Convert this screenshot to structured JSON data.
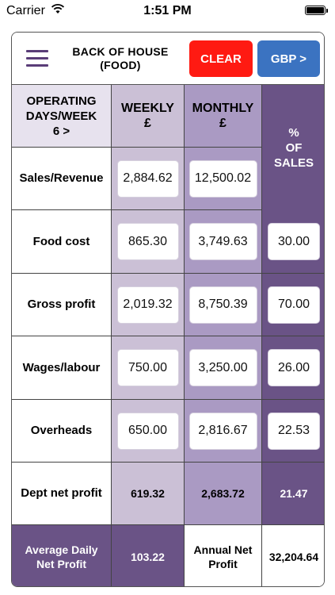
{
  "status_bar": {
    "carrier": "Carrier",
    "time": "1:51 PM"
  },
  "header": {
    "title_line1": "BACK OF HOUSE",
    "title_line2": "(FOOD)",
    "clear_label": "CLEAR",
    "currency_label": "GBP >"
  },
  "table_header": {
    "days_line1": "OPERATING",
    "days_line2": "DAYS/WEEK",
    "days_line3": "6 >",
    "weekly_line1": "WEEKLY",
    "weekly_line2": "£",
    "monthly_line1": "MONTHLY",
    "monthly_line2": "£",
    "pct_line1": "%",
    "pct_line2": "OF",
    "pct_line3": "SALES"
  },
  "rows": [
    {
      "label": "Sales/Revenue",
      "weekly": "2,884.62",
      "monthly": "12,500.02",
      "pct": ""
    },
    {
      "label": "Food cost",
      "weekly": "865.30",
      "monthly": "3,749.63",
      "pct": "30.00"
    },
    {
      "label": "Gross profit",
      "weekly": "2,019.32",
      "monthly": "8,750.39",
      "pct": "70.00"
    },
    {
      "label": "Wages/labour",
      "weekly": "750.00",
      "monthly": "3,250.00",
      "pct": "26.00"
    },
    {
      "label": "Overheads",
      "weekly": "650.00",
      "monthly": "2,816.67",
      "pct": "22.53"
    }
  ],
  "net_row": {
    "label": "Dept net profit",
    "weekly": "619.32",
    "monthly": "2,683.72",
    "pct": "21.47"
  },
  "footer_row": {
    "avg_label_line1": "Average Daily",
    "avg_label_line2": "Net Profit",
    "avg_value": "103.22",
    "annual_label_line1": "Annual Net",
    "annual_label_line2": "Profit",
    "annual_value": "32,204.64"
  },
  "colors": {
    "clear": "#ff1a12",
    "currency": "#3b73c1",
    "menu": "#5a3d78",
    "dark_purple": "#6a5386",
    "weekly_bg": "#cbc0d6",
    "monthly_bg": "#aa9ac3"
  }
}
